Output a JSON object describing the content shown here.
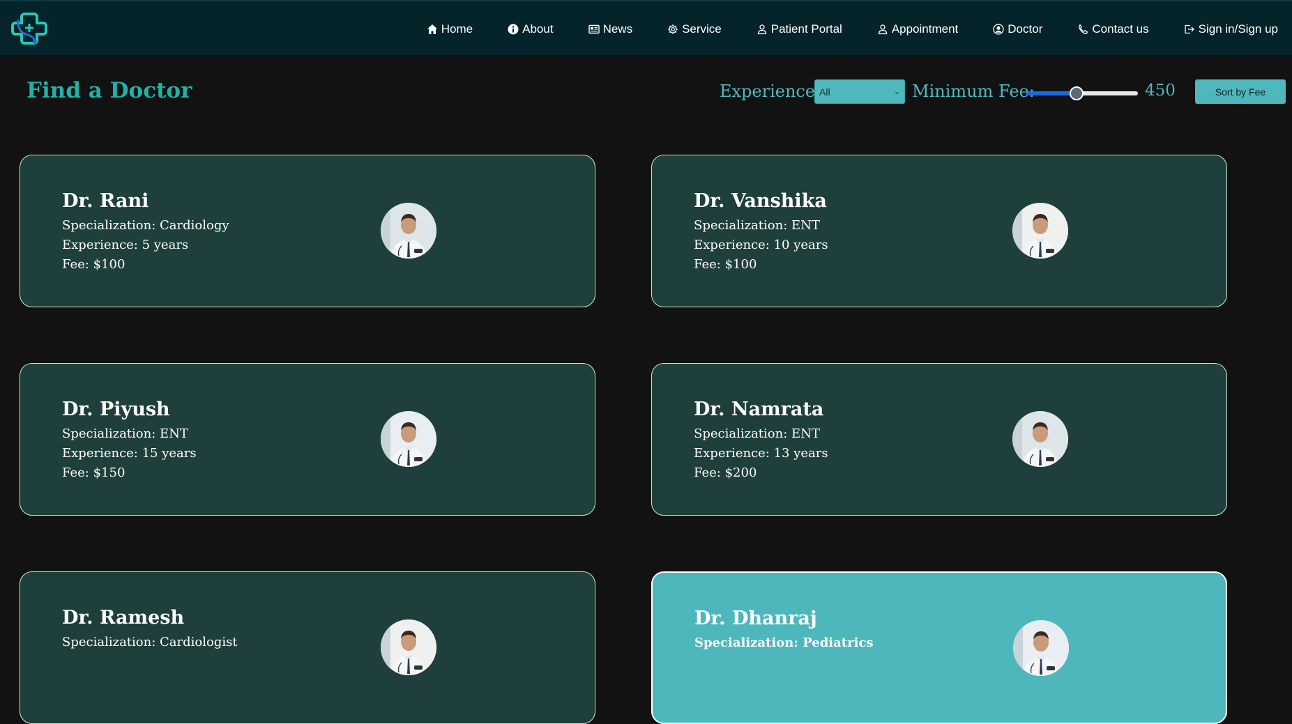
{
  "nav": {
    "items": [
      {
        "label": "Home",
        "icon": "home-icon"
      },
      {
        "label": "About",
        "icon": "info-icon"
      },
      {
        "label": "News",
        "icon": "newspaper-icon"
      },
      {
        "label": "Service",
        "icon": "gear-icon"
      },
      {
        "label": "Patient Portal",
        "icon": "user-icon"
      },
      {
        "label": "Appointment",
        "icon": "user-icon"
      },
      {
        "label": "Doctor",
        "icon": "user-circle-icon"
      },
      {
        "label": "Contact us",
        "icon": "phone-icon"
      },
      {
        "label": "Sign in/Sign up",
        "icon": "sign-out-icon"
      }
    ]
  },
  "toolbar": {
    "title": "Find a Doctor",
    "experience_label": "Experience:",
    "experience_value": "All",
    "min_fee_label": "Minimum Fee:",
    "min_fee_value": "450",
    "min_fee_fraction": 0.45,
    "sort_label": "Sort by Fee"
  },
  "colors": {
    "accent": "#20b2a6",
    "card_bg": "#1e3f3b",
    "card_active_bg": "#4eb7bb",
    "nav_bg": "#05242a",
    "page_bg": "#121212"
  },
  "doctors": [
    {
      "name": "Dr. Rani",
      "specialization": "Specialization: Cardiology",
      "experience": "Experience: 5 years",
      "fee": "Fee: $100",
      "photo": "doctor-photo"
    },
    {
      "name": "Dr. Vanshika",
      "specialization": "Specialization: ENT",
      "experience": "Experience: 10 years",
      "fee": "Fee: $100",
      "photo": "doctor-photo"
    },
    {
      "name": "Dr. Piyush",
      "specialization": "Specialization: ENT",
      "experience": "Experience: 15 years",
      "fee": "Fee: $150",
      "photo": "doctor-photo"
    },
    {
      "name": "Dr. Namrata",
      "specialization": "Specialization: ENT",
      "experience": "Experience: 13 years",
      "fee": "Fee: $200",
      "photo": "doctor-photo"
    },
    {
      "name": "Dr. Ramesh",
      "specialization": "Specialization: Cardiologist",
      "experience": "",
      "fee": "",
      "photo": "doctor-photo"
    },
    {
      "name": "Dr. Dhanraj",
      "specialization": "Specialization: Pediatrics",
      "experience": "",
      "fee": "",
      "photo": "doctor-photo",
      "active": true
    }
  ]
}
